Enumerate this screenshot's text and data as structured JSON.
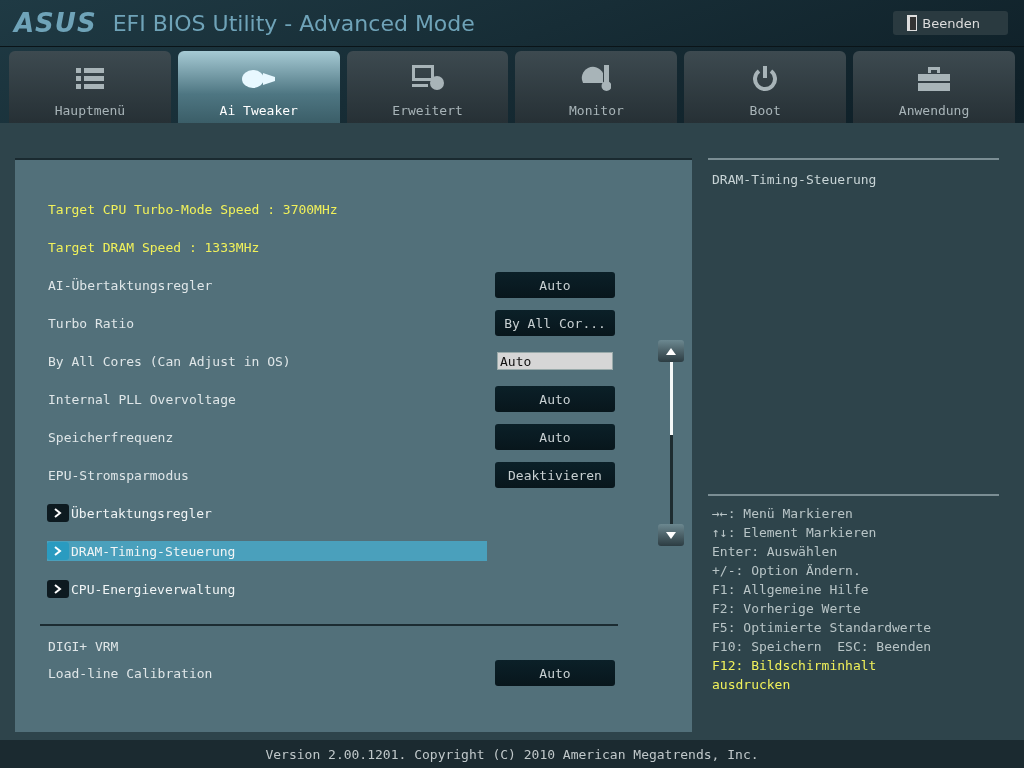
{
  "header": {
    "logo": "ASUS",
    "title": "EFI BIOS Utility - Advanced Mode",
    "exit_button": "Beenden"
  },
  "tabs": [
    {
      "label": "Hauptmenü",
      "kind": "list",
      "selected": false
    },
    {
      "label": "Ai Tweaker",
      "kind": "tweaker",
      "selected": true
    },
    {
      "label": "Erweitert",
      "kind": "info",
      "selected": false
    },
    {
      "label": "Monitor",
      "kind": "gauge",
      "selected": false
    },
    {
      "label": "Boot",
      "kind": "power",
      "selected": false
    },
    {
      "label": "Anwendung",
      "kind": "toolbox",
      "selected": false
    }
  ],
  "settings": [
    {
      "kind": "info",
      "label": "Target CPU Turbo-Mode Speed : 3700MHz"
    },
    {
      "kind": "info",
      "label": "Target DRAM Speed : 1333MHz"
    },
    {
      "kind": "option",
      "label": "AI-Übertaktungsregler",
      "value": "Auto"
    },
    {
      "kind": "option",
      "label": "Turbo Ratio",
      "value": "By All Cor..."
    },
    {
      "kind": "input",
      "label": "By All Cores (Can Adjust in OS)",
      "value": "Auto"
    },
    {
      "kind": "option",
      "label": "Internal PLL Overvoltage",
      "value": "Auto"
    },
    {
      "kind": "option",
      "label": "Speicherfrequenz",
      "value": "Auto"
    },
    {
      "kind": "option",
      "label": "EPU-Stromsparmodus",
      "value": "Deaktivieren"
    },
    {
      "kind": "submenu",
      "label": "Übertaktungsregler",
      "selected": false
    },
    {
      "kind": "submenu",
      "label": "DRAM-Timing-Steuerung",
      "selected": true
    },
    {
      "kind": "submenu",
      "label": "CPU-Energieverwaltung",
      "selected": false
    },
    {
      "kind": "separator"
    },
    {
      "kind": "heading",
      "label": "DIGI+ VRM"
    },
    {
      "kind": "option",
      "label": "Load-line Calibration",
      "value": "Auto"
    }
  ],
  "description": "DRAM-Timing-Steuerung",
  "help": [
    {
      "text": "→←: Menü Markieren",
      "highlighted": false
    },
    {
      "text": "↑↓: Element Markieren",
      "highlighted": false
    },
    {
      "text": "Enter: Auswählen",
      "highlighted": false
    },
    {
      "text": "+/-: Option Ändern.",
      "highlighted": false
    },
    {
      "text": "F1: Allgemeine Hilfe",
      "highlighted": false
    },
    {
      "text": "F2: Vorherige Werte",
      "highlighted": false
    },
    {
      "text": "F5: Optimierte Standardwerte",
      "highlighted": false
    },
    {
      "text": "F10: Speichern  ESC: Beenden",
      "highlighted": false
    },
    {
      "text": "F12: Bildschirminhalt ausdrucken",
      "highlighted": true
    }
  ],
  "status_bar": "Version 2.00.1201. Copyright (C) 2010 American Megatrends, Inc."
}
